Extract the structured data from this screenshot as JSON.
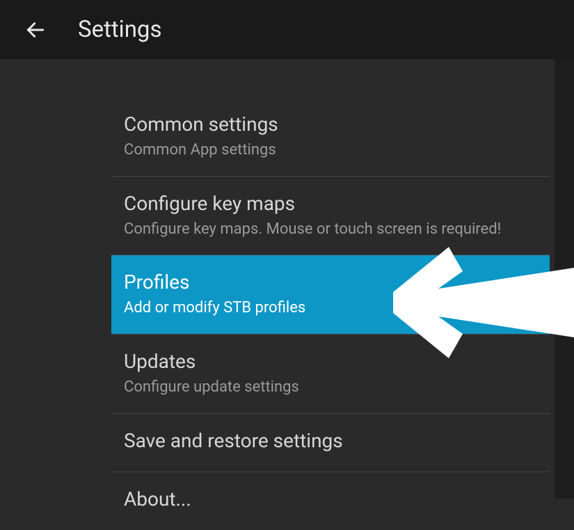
{
  "header": {
    "title": "Settings"
  },
  "items": [
    {
      "title": "Common settings",
      "subtitle": "Common App settings",
      "selected": false
    },
    {
      "title": "Configure key maps",
      "subtitle": "Configure key maps. Mouse or touch screen is required!",
      "selected": false
    },
    {
      "title": "Profiles",
      "subtitle": "Add or modify STB profiles",
      "selected": true
    },
    {
      "title": "Updates",
      "subtitle": "Configure update settings",
      "selected": false
    },
    {
      "title": "Save and restore settings",
      "subtitle": "",
      "selected": false
    },
    {
      "title": "About...",
      "subtitle": "",
      "selected": false
    }
  ]
}
